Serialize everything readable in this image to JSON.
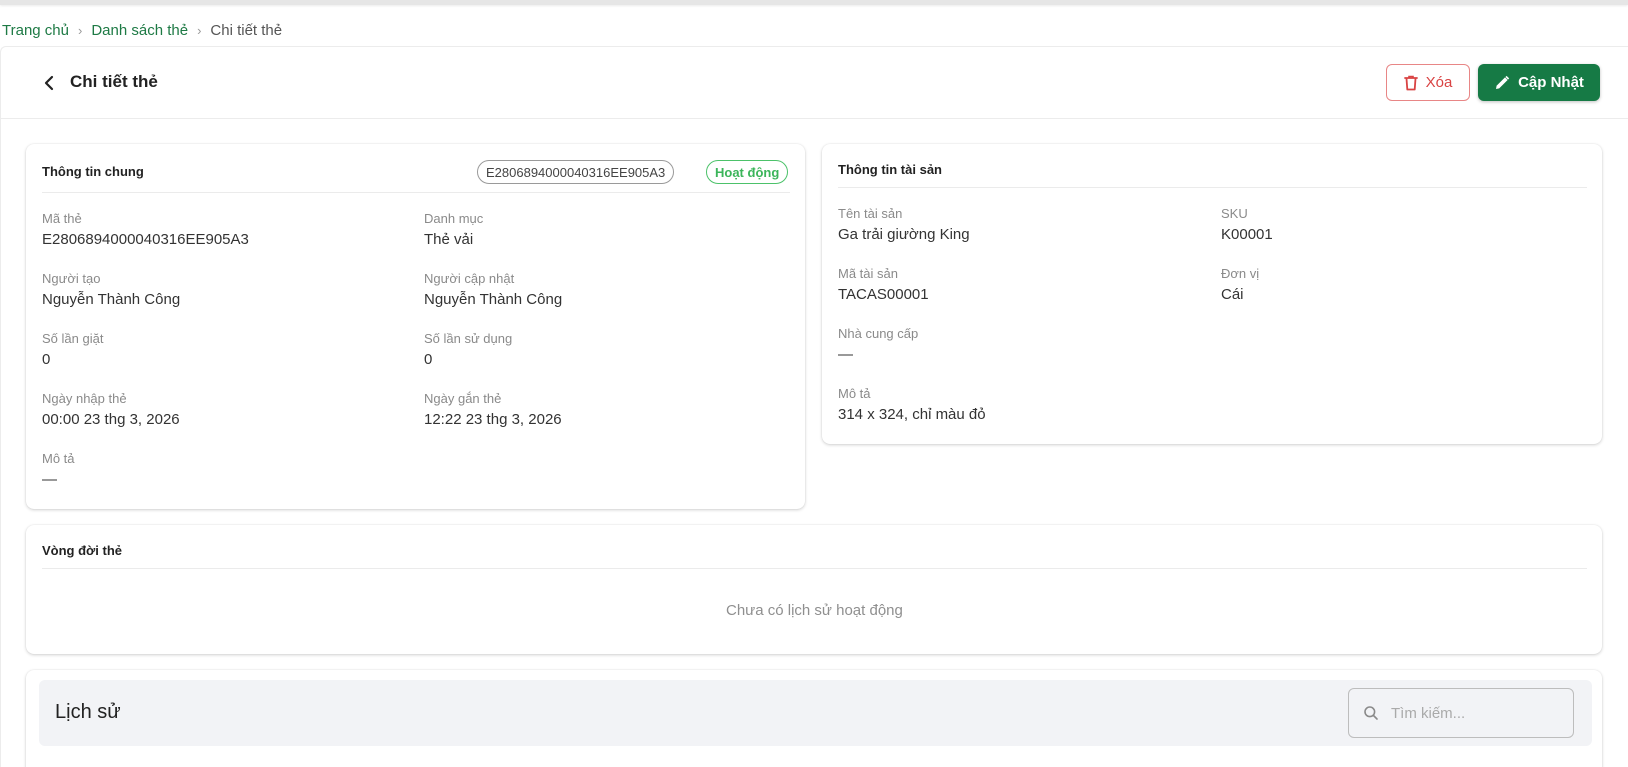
{
  "breadcrumb": {
    "home": "Trang chủ",
    "list": "Danh sách thẻ",
    "current": "Chi tiết thẻ",
    "separator": "›"
  },
  "header": {
    "title": "Chi tiết thẻ",
    "delete_label": "Xóa",
    "update_label": "Cập Nhật"
  },
  "general_info": {
    "title": "Thông tin chung",
    "tag_code_chip": "E2806894000040316EE905A3",
    "status": "Hoạt động",
    "fields": {
      "tag_code_label": "Mã thẻ",
      "tag_code_value": "E2806894000040316EE905A3",
      "category_label": "Danh mục",
      "category_value": "Thẻ vải",
      "creator_label": "Người tạo",
      "creator_value": "Nguyễn Thành Công",
      "updater_label": "Người cập nhật",
      "updater_value": "Nguyễn Thành Công",
      "wash_count_label": "Số lần giặt",
      "wash_count_value": "0",
      "use_count_label": "Số lần sử dụng",
      "use_count_value": "0",
      "import_date_label": "Ngày nhập thẻ",
      "import_date_value": "00:00 23 thg 3, 2026",
      "attach_date_label": "Ngày gắn thẻ",
      "attach_date_value": "12:22 23 thg 3, 2026",
      "description_label": "Mô tả",
      "description_value": "—"
    }
  },
  "asset_info": {
    "title": "Thông tin tài sản",
    "fields": {
      "asset_name_label": "Tên tài sản",
      "asset_name_value": "Ga trải giường King",
      "sku_label": "SKU",
      "sku_value": "K00001",
      "asset_code_label": "Mã tài sản",
      "asset_code_value": "TACAS00001",
      "unit_label": "Đơn vị",
      "unit_value": "Cái",
      "supplier_label": "Nhà cung cấp",
      "supplier_value": "—",
      "description_label": "Mô tả",
      "description_value": "314 x 324, chỉ màu đỏ"
    }
  },
  "lifecycle": {
    "title": "Vòng đời thẻ",
    "empty_text": "Chưa có lịch sử hoạt động"
  },
  "history": {
    "title": "Lịch sử",
    "search_placeholder": "Tìm kiếm..."
  },
  "colors": {
    "brand": "#167a45",
    "link": "#1e7a45",
    "danger": "#d94343",
    "status_active": "#3bb55a"
  },
  "icons": {
    "back": "chevron-left-icon",
    "delete": "trash-icon",
    "update": "pencil-icon",
    "search": "search-icon"
  }
}
